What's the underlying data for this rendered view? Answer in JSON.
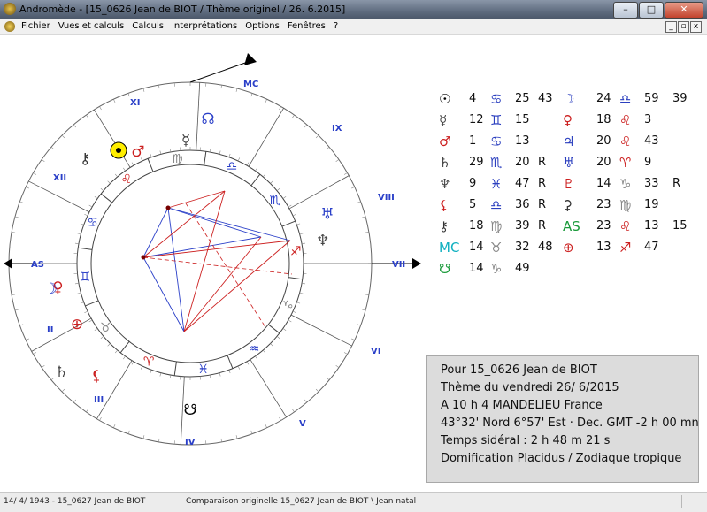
{
  "window": {
    "title": "Andromède - [15_0626 Jean de BIOT / Thème originel / 26. 6.2015]",
    "buttons": {
      "minimize": "–",
      "maximize": "□",
      "close": "✕"
    }
  },
  "menubar": {
    "items": [
      "Fichier",
      "Vues et calculs",
      "Calculs",
      "Interprétations",
      "Options",
      "Fenêtres",
      "?"
    ],
    "mdi_buttons": [
      "_",
      "▫",
      "x"
    ]
  },
  "wheel": {
    "house_labels": {
      "MC": "MC",
      "XI": "XI",
      "XII": "XII",
      "AS": "AS",
      "II": "II",
      "III": "III",
      "IV": "IV",
      "V": "V",
      "VI": "VI",
      "VII": "VII",
      "VIII": "VIII",
      "IX": "IX"
    },
    "sign_ring": [
      "♋",
      "♌",
      "♍",
      "♎",
      "♏",
      "♐",
      "♑",
      "♒",
      "♓",
      "♈",
      "♉",
      "♊"
    ],
    "outer_planets": [
      "☉",
      "♂",
      "☿",
      "☊",
      "♅",
      "♆",
      "♀",
      "⚷",
      "♄",
      "☽",
      "⊕",
      "⚸",
      "☋"
    ],
    "sun_color": "#ffee00",
    "accent_colors": {
      "red": "#cc2020",
      "blue": "#2a3fc8",
      "dark": "#222222"
    }
  },
  "positions": {
    "rows": [
      [
        {
          "g": "☉",
          "c": "#000"
        },
        "4",
        {
          "g": "♋",
          "c": "#2b3fbf"
        },
        "25",
        "43",
        {
          "g": "☽",
          "c": "#2b3fbf"
        },
        "24",
        {
          "g": "♎",
          "c": "#2b3fbf"
        },
        "59",
        "39"
      ],
      [
        {
          "g": "☿",
          "c": "#444"
        },
        "12",
        {
          "g": "♊",
          "c": "#2b3fbf"
        },
        "15",
        "",
        {
          "g": "♀",
          "c": "#cc2020"
        },
        "18",
        {
          "g": "♌",
          "c": "#cc2020"
        },
        "3",
        ""
      ],
      [
        {
          "g": "♂",
          "c": "#cc2020"
        },
        "1",
        {
          "g": "♋",
          "c": "#2b3fbf"
        },
        "13",
        "",
        {
          "g": "♃",
          "c": "#2b3fbf"
        },
        "20",
        {
          "g": "♌",
          "c": "#cc2020"
        },
        "43",
        ""
      ],
      [
        {
          "g": "♄",
          "c": "#444"
        },
        "29",
        {
          "g": "♏",
          "c": "#2b3fbf"
        },
        "20",
        "R",
        {
          "g": "♅",
          "c": "#2b3fbf"
        },
        "20",
        {
          "g": "♈",
          "c": "#cc2020"
        },
        "9",
        ""
      ],
      [
        {
          "g": "♆",
          "c": "#444"
        },
        "9",
        {
          "g": "♓",
          "c": "#2b3fbf"
        },
        "47",
        "R",
        {
          "g": "♇",
          "c": "#cc2020"
        },
        "14",
        {
          "g": "♑",
          "c": "#888"
        },
        "33",
        "R"
      ],
      [
        {
          "g": "⚸",
          "c": "#cc2020"
        },
        "5",
        {
          "g": "♎",
          "c": "#2b3fbf"
        },
        "36",
        "R",
        {
          "g": "⚳",
          "c": "#333"
        },
        "23",
        {
          "g": "♍",
          "c": "#888"
        },
        "19",
        ""
      ],
      [
        {
          "g": "⚷",
          "c": "#333"
        },
        "18",
        {
          "g": "♍",
          "c": "#888"
        },
        "39",
        "R",
        {
          "g": "AS",
          "c": "#1a9a3a"
        },
        "23",
        {
          "g": "♌",
          "c": "#cc2020"
        },
        "13",
        "15"
      ],
      [
        {
          "g": "MC",
          "c": "#10b0c0"
        },
        "14",
        {
          "g": "♉",
          "c": "#888"
        },
        "32",
        "48",
        {
          "g": "⊕",
          "c": "#cc2020"
        },
        "13",
        {
          "g": "♐",
          "c": "#cc2020"
        },
        "47",
        ""
      ],
      [
        {
          "g": "☋",
          "c": "#1a9a3a"
        },
        "14",
        {
          "g": "♑",
          "c": "#888"
        },
        "49",
        "",
        {
          "g": "",
          "c": "#000"
        },
        "",
        {
          "g": "",
          "c": "#000"
        },
        "",
        ""
      ]
    ]
  },
  "info": {
    "line1": "Pour 15_0626 Jean de BIOT",
    "line2": "Thème du vendredi  26/ 6/2015",
    "line3": " A 10 h  4 MANDELIEU France",
    "line4": "43°32' Nord    6°57' Est · Dec. GMT -2 h 00 mn",
    "line5": "Temps sidéral :  2 h 48 m 21 s",
    "line6": "Domification Placidus / Zodiaque tropique"
  },
  "statusbar": {
    "left": "14/ 4/ 1943 - 15_0627 Jean de BIOT",
    "right": "Comparaison originelle 15_0627 Jean de BIOT \\ Jean natal"
  }
}
